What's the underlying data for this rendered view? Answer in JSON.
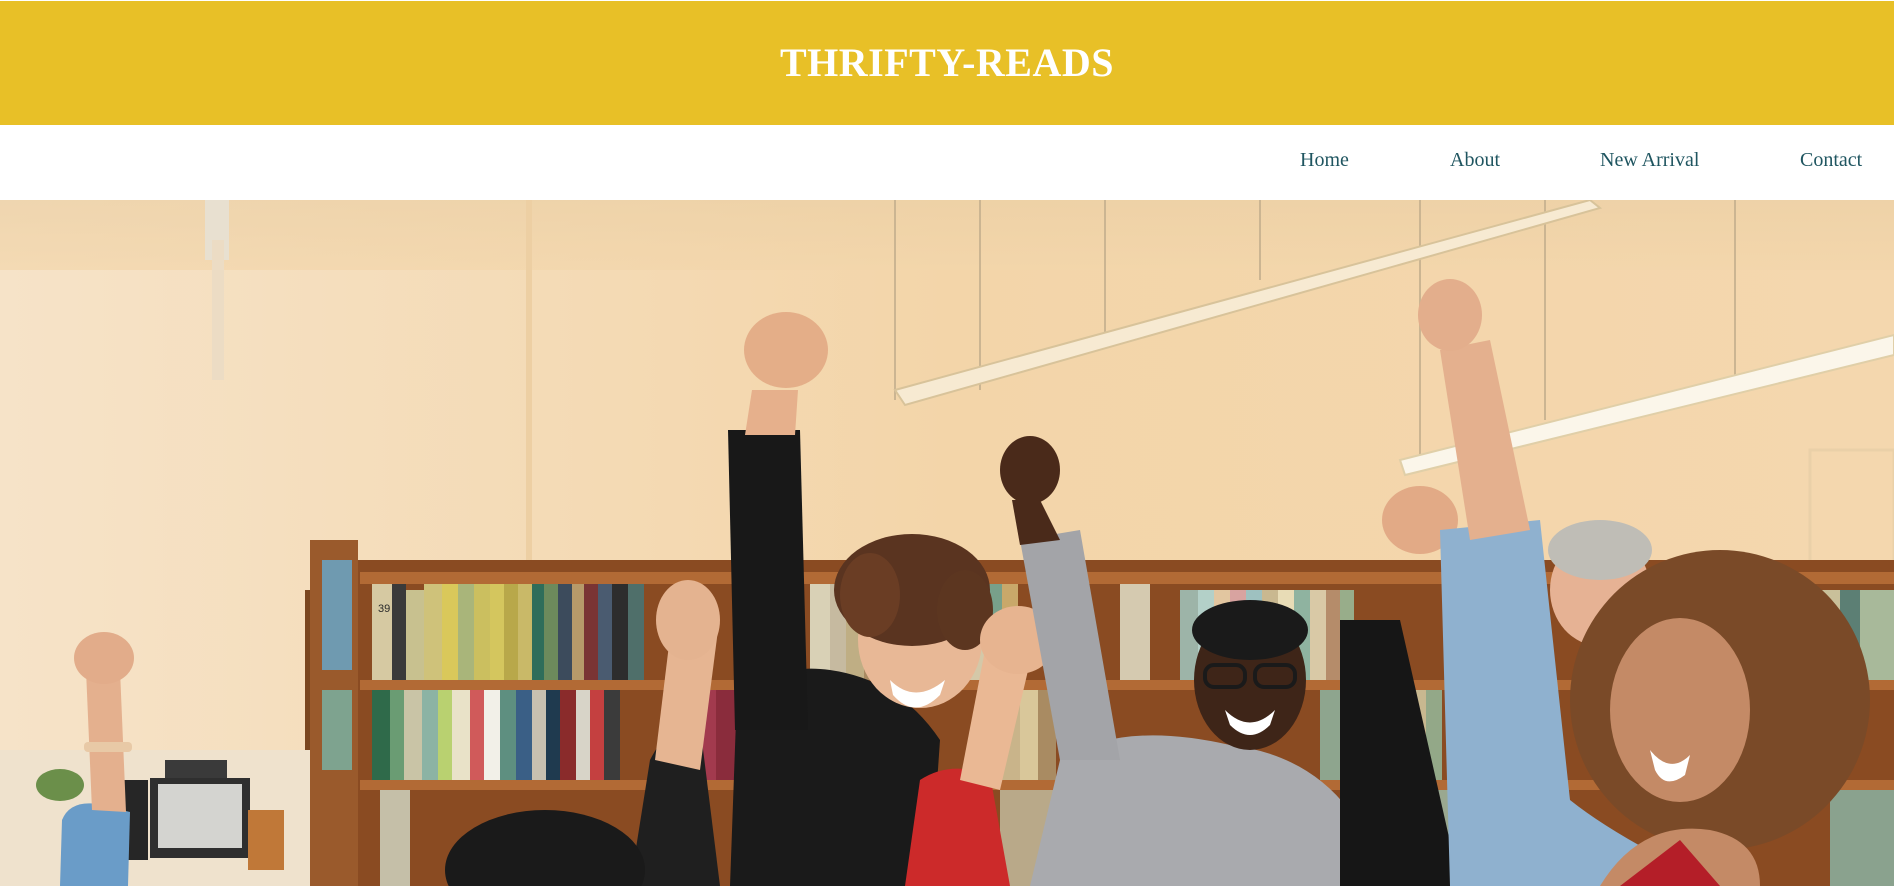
{
  "site": {
    "title": "THRIFTY-READS"
  },
  "nav": {
    "items": [
      {
        "label": "Home"
      },
      {
        "label": "About"
      },
      {
        "label": "New Arrival"
      },
      {
        "label": "Contact"
      }
    ]
  },
  "colors": {
    "header_bg": "#e8c027",
    "title_text": "#ffffff",
    "nav_text": "#1f5560",
    "wall": "#f3d6ad"
  },
  "hero": {
    "shelf_label": "39"
  }
}
